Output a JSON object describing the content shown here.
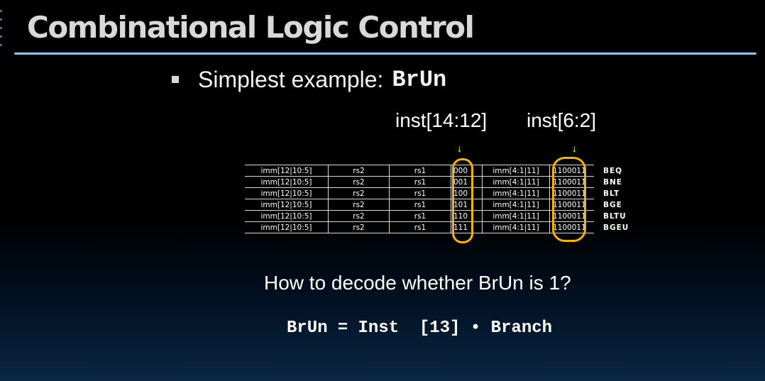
{
  "slide": {
    "title": "Combinational Logic Control",
    "bullet_text": "Simplest example:",
    "bullet_code": "BrUn",
    "label_funct3": "inst[14:12]",
    "label_opcode": "inst[6:2]",
    "arrow_symbol": "↓",
    "question": "How to decode whether BrUn is 1?",
    "formula": {
      "lhs": "BrUn",
      "eq": "=",
      "rhs": "Inst  [13] • Branch"
    }
  },
  "encoding_table": {
    "rows": [
      {
        "imm_hi": "imm[12|10:5]",
        "rs2": "rs2",
        "rs1": "rs1",
        "funct3": "000",
        "imm_lo": "imm[4:1|11]",
        "opcode": "1100011",
        "name": "BEQ"
      },
      {
        "imm_hi": "imm[12|10:5]",
        "rs2": "rs2",
        "rs1": "rs1",
        "funct3": "001",
        "imm_lo": "imm[4:1|11]",
        "opcode": "1100011",
        "name": "BNE"
      },
      {
        "imm_hi": "imm[12|10:5]",
        "rs2": "rs2",
        "rs1": "rs1",
        "funct3": "100",
        "imm_lo": "imm[4:1|11]",
        "opcode": "1100011",
        "name": "BLT"
      },
      {
        "imm_hi": "imm[12|10:5]",
        "rs2": "rs2",
        "rs1": "rs1",
        "funct3": "101",
        "imm_lo": "imm[4:1|11]",
        "opcode": "1100011",
        "name": "BGE"
      },
      {
        "imm_hi": "imm[12|10:5]",
        "rs2": "rs2",
        "rs1": "rs1",
        "funct3": "110",
        "imm_lo": "imm[4:1|11]",
        "opcode": "1100011",
        "name": "BLTU"
      },
      {
        "imm_hi": "imm[12|10:5]",
        "rs2": "rs2",
        "rs1": "rs1",
        "funct3": "111",
        "imm_lo": "imm[4:1|11]",
        "opcode": "1100011",
        "name": "BGEU"
      }
    ]
  },
  "colors": {
    "title_rule": "#8ec4ec",
    "highlight_oval": "#f5b400",
    "arrow_glow": "#c8ff60"
  }
}
